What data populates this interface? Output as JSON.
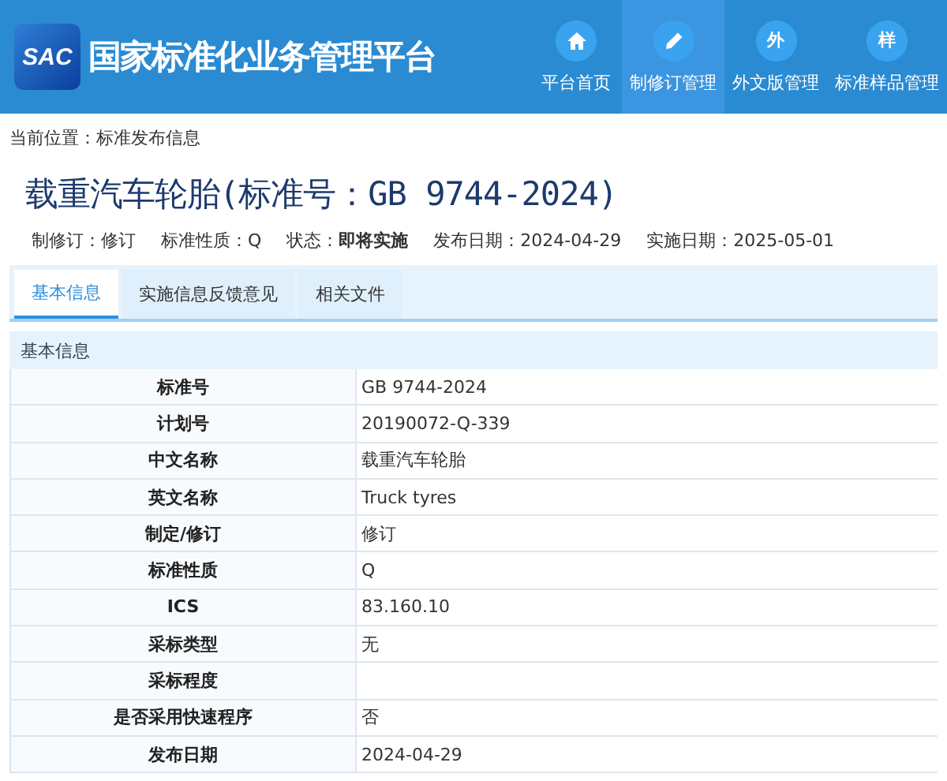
{
  "header": {
    "logo": "SAC",
    "title": "国家标准化业务管理平台",
    "nav": [
      {
        "label": "平台首页",
        "kind": "home",
        "selected": false
      },
      {
        "label": "制修订管理",
        "kind": "pencil",
        "selected": true
      },
      {
        "label": "外文版管理",
        "kind": "char",
        "char": "外",
        "selected": false
      },
      {
        "label": "标准样品管理",
        "kind": "char",
        "char": "样",
        "selected": false
      }
    ]
  },
  "breadcrumb": "当前位置：标准发布信息",
  "title": "载重汽车轮胎(标准号：GB 9744-2024)",
  "meta": [
    {
      "label": "制修订：",
      "value": "修订",
      "bold": false
    },
    {
      "label": "标准性质：",
      "value": "Q",
      "bold": false
    },
    {
      "label": "状态：",
      "value": "即将实施",
      "bold": true
    },
    {
      "label": "发布日期：",
      "value": "2024-04-29",
      "bold": false
    },
    {
      "label": "实施日期：",
      "value": "2025-05-01",
      "bold": false
    }
  ],
  "tabs": [
    {
      "label": "基本信息",
      "selected": true
    },
    {
      "label": "实施信息反馈意见",
      "selected": false
    },
    {
      "label": "相关文件",
      "selected": false
    }
  ],
  "section": {
    "title": "基本信息",
    "rows": [
      {
        "label": "标准号",
        "value": "GB 9744-2024"
      },
      {
        "label": "计划号",
        "value": "20190072-Q-339"
      },
      {
        "label": "中文名称",
        "value": "载重汽车轮胎"
      },
      {
        "label": "英文名称",
        "value": "Truck tyres"
      },
      {
        "label": "制定/修订",
        "value": "修订"
      },
      {
        "label": "标准性质",
        "value": "Q"
      },
      {
        "label": "ICS",
        "value": "83.160.10"
      },
      {
        "label": "采标类型",
        "value": "无"
      },
      {
        "label": "采标程度"
      },
      {
        "label": "是否采用快速程序",
        "value": "否"
      },
      {
        "label": "发布日期",
        "value": "2024-04-29"
      }
    ]
  }
}
